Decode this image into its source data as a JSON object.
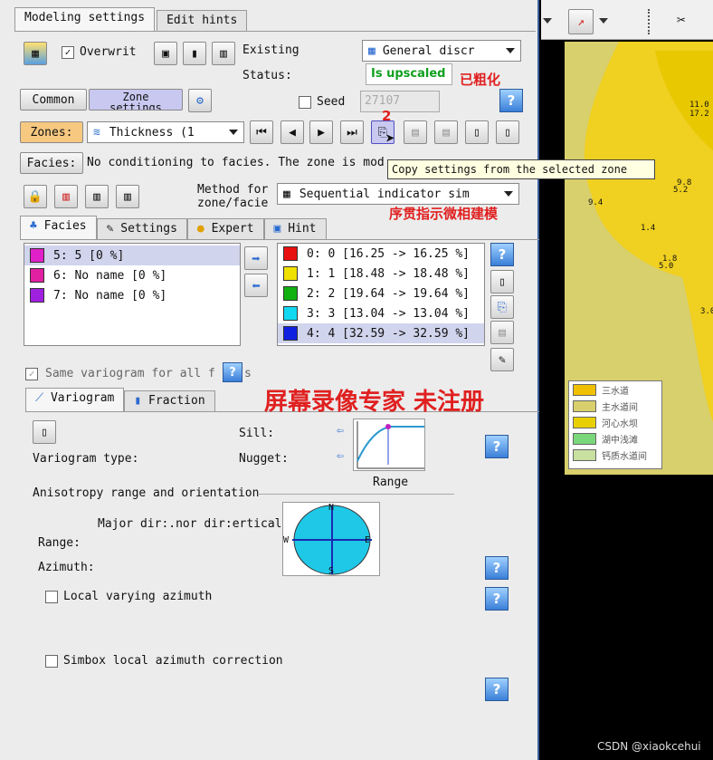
{
  "tabs": {
    "modeling": "Modeling settings",
    "hints": "Edit hints"
  },
  "overwrite_label": "Overwrit",
  "existing_label": "Existing",
  "status_label": "Status:",
  "status_value": "Is upscaled",
  "discrete_combo": "General discr",
  "ann_upscaled": "已粗化",
  "common_btn": "Common",
  "zone_settings_btn": "Zone\nsettings",
  "seed_label": "Seed",
  "seed_value": "27107",
  "zones_btn": "Zones:",
  "zone_combo": "Thickness (1",
  "ann_2": "2",
  "facies_btn": "Facies:",
  "facies_msg": "No conditioning to facies. The zone is mod",
  "tooltip": "Copy settings from the selected zone",
  "method_label": "Method for\nzone/facie",
  "method_combo": "Sequential indicator sim",
  "ann_sis": "序贯指示微相建模",
  "sub_tabs": {
    "facies": "Facies",
    "settings": "Settings",
    "expert": "Expert",
    "hint": "Hint"
  },
  "left_list": [
    {
      "label": "5: 5 [0 %]",
      "color": "#e020c8",
      "selected": true
    },
    {
      "label": "6: No name [0 %]",
      "color": "#e020a0",
      "selected": false
    },
    {
      "label": "7: No name [0 %]",
      "color": "#a020e0",
      "selected": false
    }
  ],
  "right_list": [
    {
      "label": "0: 0 [16.25 -> 16.25 %]",
      "color": "#e81010",
      "selected": false
    },
    {
      "label": "1: 1 [18.48 -> 18.48 %]",
      "color": "#f0e000",
      "selected": false
    },
    {
      "label": "2: 2 [19.64 -> 19.64 %]",
      "color": "#10b010",
      "selected": false
    },
    {
      "label": "3: 3 [13.04 -> 13.04 %]",
      "color": "#10d8f0",
      "selected": false
    },
    {
      "label": "4: 4 [32.59 -> 32.59 %]",
      "color": "#1020e0",
      "selected": true
    }
  ],
  "same_variogram": "Same variogram for all f",
  "same_variogram_s": "s",
  "var_tabs": {
    "variogram": "Variogram",
    "fraction": "Fraction"
  },
  "watermark": "屏幕录像专家  未注册",
  "sill_label": "Sill:",
  "nugget_label": "Nugget:",
  "variogram_type_label": "Variogram type:",
  "range_label_top": "Range",
  "aniso_label": "Anisotropy range and orientation",
  "dir_labels": "Major dir:.nor dir:ertical",
  "range_label": "Range:",
  "azimuth_label": "Azimuth:",
  "compass": {
    "n": "N",
    "s": "S",
    "e": "E",
    "w": "W"
  },
  "local_azimuth": "Local varying azimuth",
  "simbox": "Simbox local azimuth correction",
  "help_q": "?",
  "map_labels": [
    "11.0",
    "17.2",
    "5.2",
    "9.8",
    "9.4",
    "1.4",
    "5.0",
    "1.8",
    "3.0"
  ],
  "legend": [
    {
      "label": "三水道",
      "color": "#f0c000"
    },
    {
      "label": "主水道间",
      "color": "#d8cf6d"
    },
    {
      "label": "河心水坝",
      "color": "#e8d000"
    },
    {
      "label": "湖中浅滩",
      "color": "#7ad87a"
    },
    {
      "label": "钙质水道间",
      "color": "#c8e0a0"
    }
  ],
  "csdn": "CSDN @xiaokcehui"
}
